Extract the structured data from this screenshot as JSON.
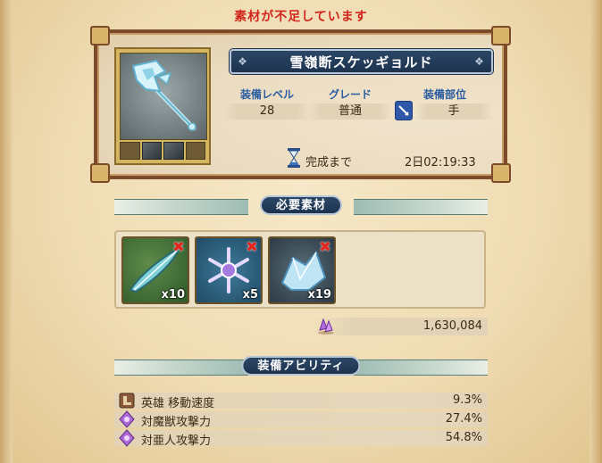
{
  "warning": "素材が不足しています",
  "item": {
    "name": "雪嶺断スケッギョルド",
    "level_label": "装備レベル",
    "level_value": "28",
    "grade_label": "グレード",
    "grade_value": "普通",
    "slot_label": "装備部位",
    "slot_value": "手",
    "time_label": "完成まで",
    "time_value": "2日02:19:33"
  },
  "materials_header": "必要素材",
  "materials": [
    {
      "name": "feather-material-icon",
      "qty": "x10",
      "insufficient": true
    },
    {
      "name": "snowflake-material-icon",
      "qty": "x5",
      "insufficient": true
    },
    {
      "name": "ice-crystal-material-icon",
      "qty": "x19",
      "insufficient": true
    }
  ],
  "cost": "1,630,084",
  "abilities_header": "装備アビリティ",
  "abilities": [
    {
      "name": "英雄 移動速度",
      "value": "9.3%",
      "icon": "hero-boot-icon"
    },
    {
      "name": "対魔獣攻撃力",
      "value": "27.4%",
      "icon": "purple-gem-icon"
    },
    {
      "name": "対亜人攻撃力",
      "value": "54.8%",
      "icon": "purple-gem-icon"
    }
  ],
  "colors": {
    "warning": "#d0261b",
    "banner": "#1d3350",
    "label": "#2a5ca0",
    "frame": "#7d4a2a"
  }
}
